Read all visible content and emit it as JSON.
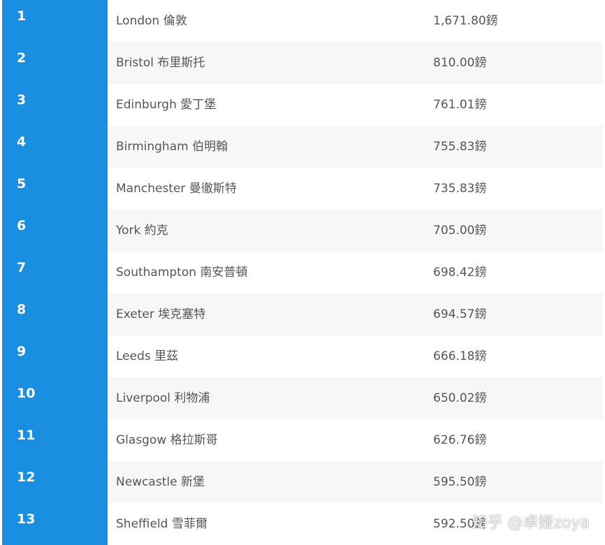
{
  "rows": [
    {
      "rank": "1",
      "city": "London 倫敦",
      "price": "1,671.80鎊"
    },
    {
      "rank": "2",
      "city": "Bristol 布里斯托",
      "price": "810.00鎊"
    },
    {
      "rank": "3",
      "city": "Edinburgh 愛丁堡",
      "price": "761.01鎊"
    },
    {
      "rank": "4",
      "city": "Birmingham 伯明翰",
      "price": "755.83鎊"
    },
    {
      "rank": "5",
      "city": "Manchester 曼徹斯特",
      "price": "735.83鎊"
    },
    {
      "rank": "6",
      "city": "York 約克",
      "price": "705.00鎊"
    },
    {
      "rank": "7",
      "city": "Southampton 南安普頓",
      "price": "698.42鎊"
    },
    {
      "rank": "8",
      "city": "Exeter 埃克塞特",
      "price": "694.57鎊"
    },
    {
      "rank": "9",
      "city": "Leeds 里茲",
      "price": "666.18鎊"
    },
    {
      "rank": "10",
      "city": "Liverpool 利物浦",
      "price": "650.02鎊"
    },
    {
      "rank": "11",
      "city": "Glasgow 格拉斯哥",
      "price": "626.76鎊"
    },
    {
      "rank": "12",
      "city": "Newcastle 新堡",
      "price": "595.50鎊"
    },
    {
      "rank": "13",
      "city": "Sheffield 雪菲爾",
      "price": "592.50鎊"
    }
  ],
  "watermark": "知乎 @卓娅zoya",
  "colors": {
    "rank_column": "#1a8ee0",
    "stripe": "#f7f7f7",
    "text": "#555555"
  }
}
